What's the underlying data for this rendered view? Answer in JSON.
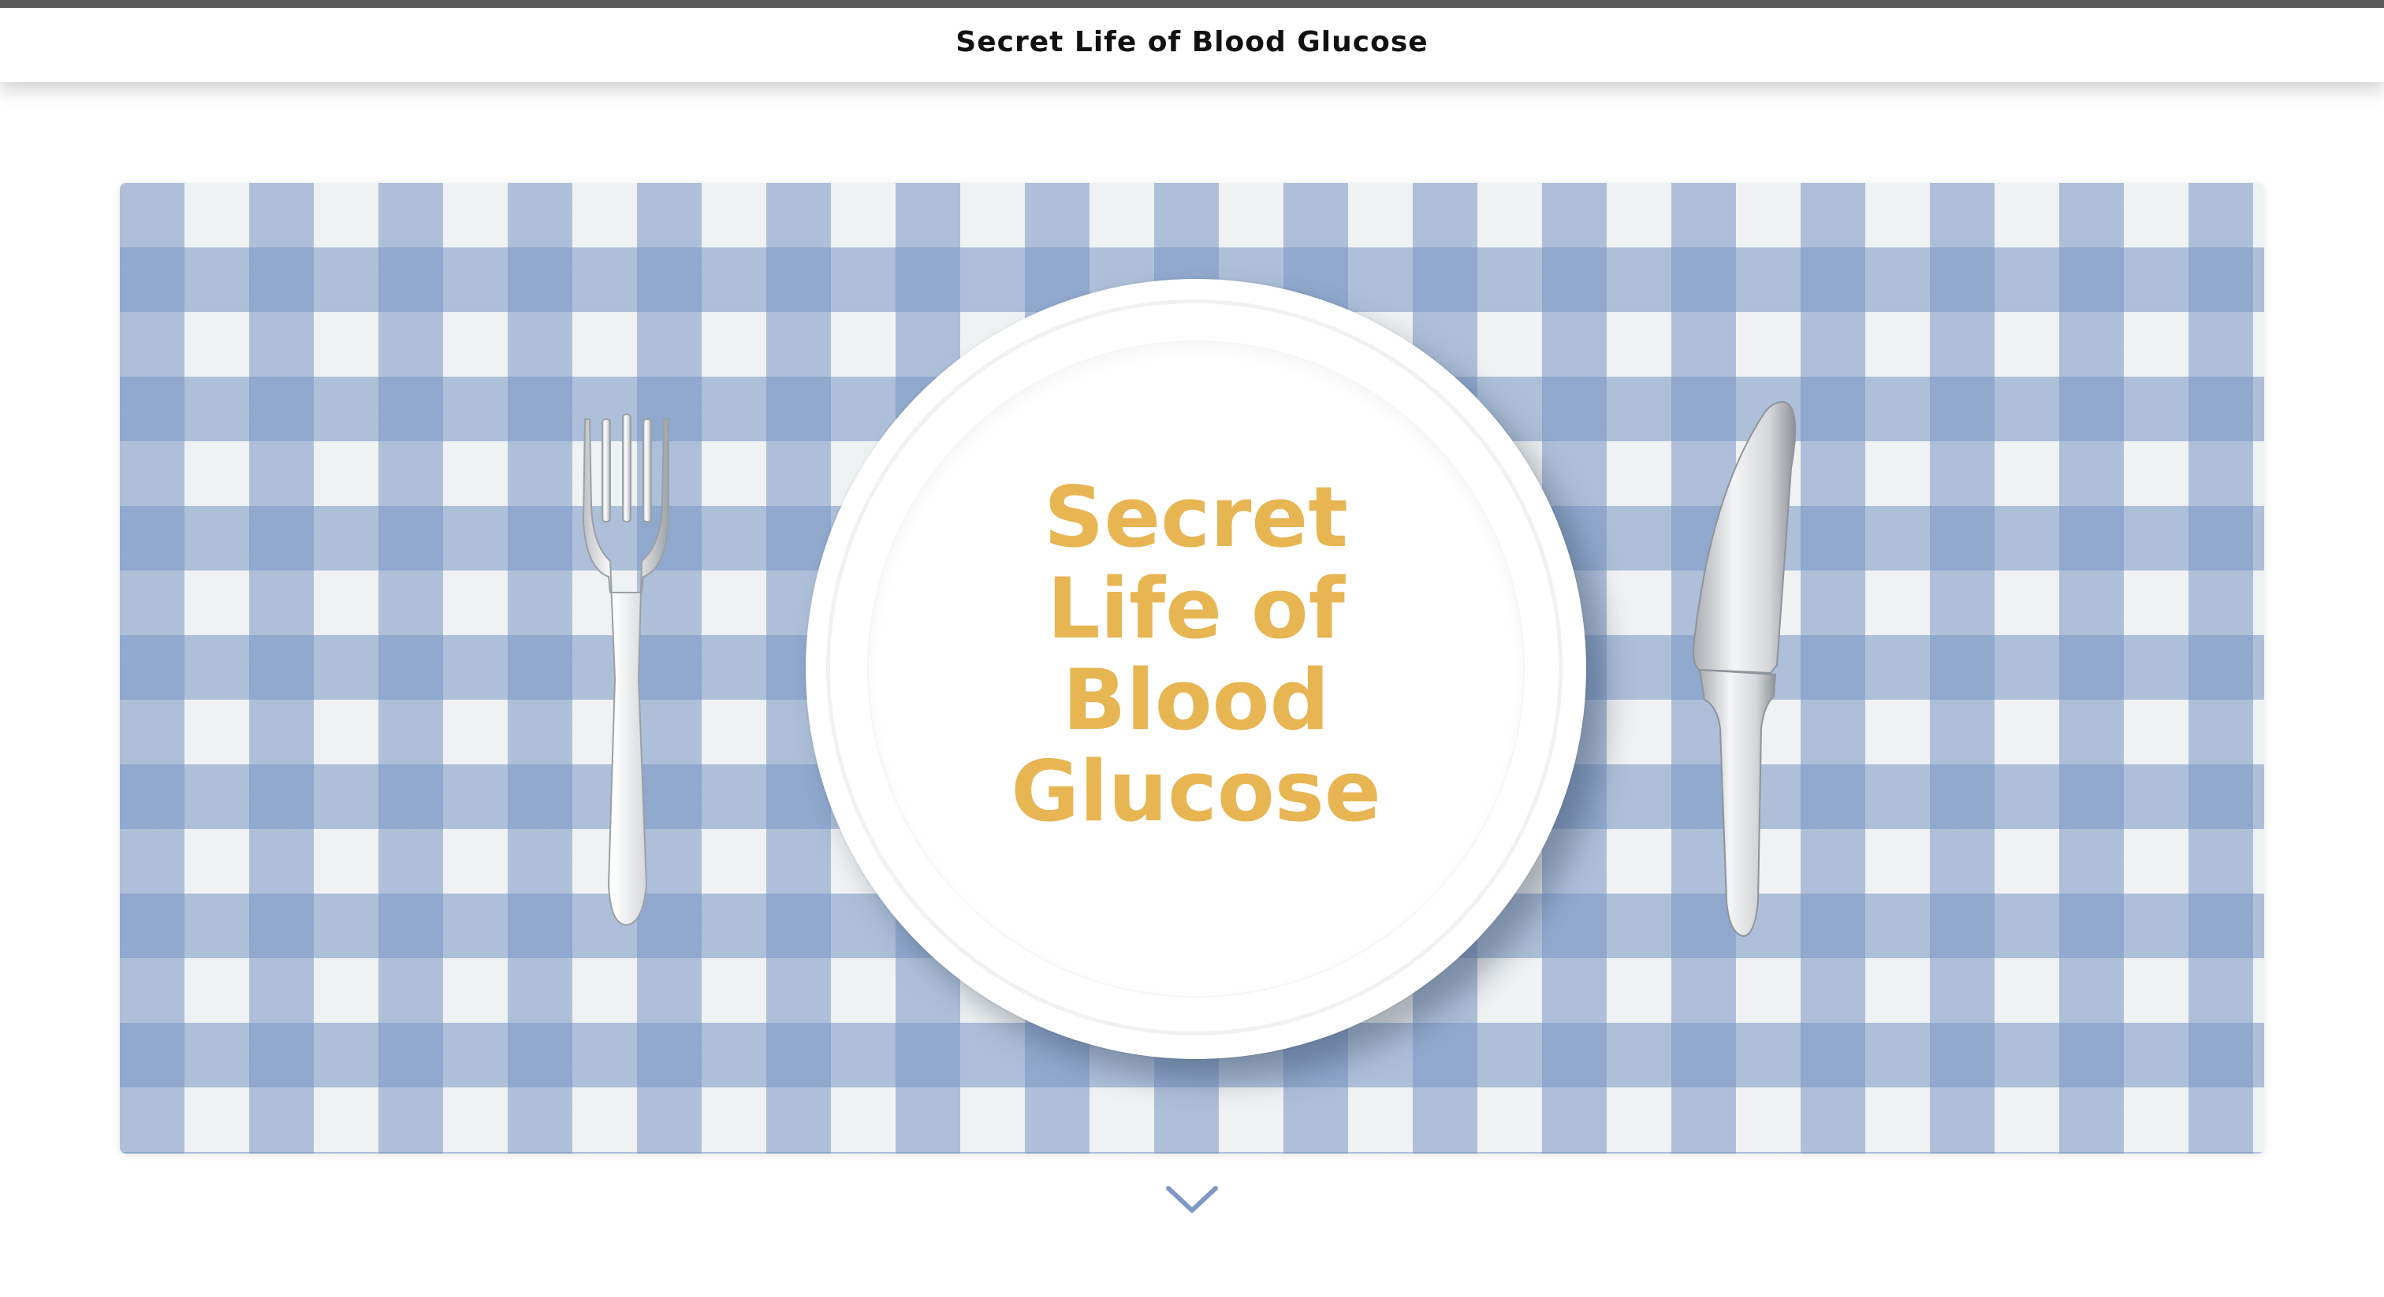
{
  "header": {
    "title": "Secret Life of Blood Glucose"
  },
  "hero": {
    "title": "Secret Life of Blood Glucose",
    "tablecloth_colors": [
      "#eff2f3",
      "#b0c2d8",
      "#93acce"
    ],
    "title_color": "#e8b553"
  },
  "icons": {
    "fork": "fork-icon",
    "knife": "knife-icon",
    "scroll": "chevron-down-icon"
  }
}
